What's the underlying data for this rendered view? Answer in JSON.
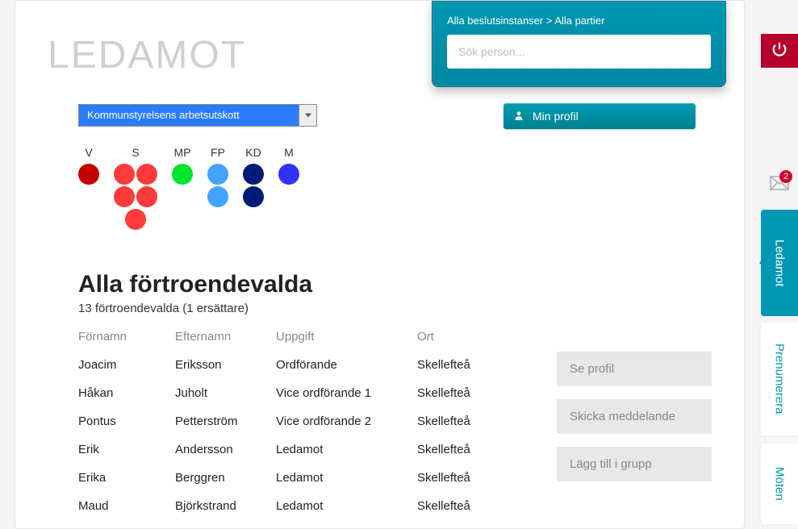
{
  "title": "LEDAMOT",
  "search": {
    "breadcrumb": "Alla beslutsinstanser > Alla partier",
    "placeholder": "Sök person..."
  },
  "dropdown": {
    "selected": "Kommunstyrelsens arbetsutskott"
  },
  "profile_button": "Min profil",
  "parties": [
    {
      "code": "V",
      "color": "#c40000",
      "rows": [
        [
          1
        ]
      ]
    },
    {
      "code": "S",
      "color": "#ff3a3a",
      "rows": [
        [
          1,
          1
        ],
        [
          1,
          1
        ],
        [
          1
        ]
      ]
    },
    {
      "code": "MP",
      "color": "#00e52e",
      "rows": [
        [
          1
        ]
      ]
    },
    {
      "code": "FP",
      "color": "#40a4ff",
      "rows": [
        [
          1
        ],
        [
          1
        ]
      ]
    },
    {
      "code": "KD",
      "color": "#001a78",
      "rows": [
        [
          1
        ],
        [
          1
        ]
      ]
    },
    {
      "code": "M",
      "color": "#3030ff",
      "rows": [
        [
          1
        ]
      ]
    }
  ],
  "section": {
    "title": "Alla förtroendevalda",
    "subtitle": "13 förtroendevalda (1 ersättare)",
    "columns": {
      "fornamn": "Förnamn",
      "efternamn": "Efternamn",
      "uppgift": "Uppgift",
      "ort": "Ort"
    },
    "rows": [
      {
        "fornamn": "Joacim",
        "efternamn": "Eriksson",
        "uppgift": "Ordförande",
        "ort": "Skellefteå"
      },
      {
        "fornamn": "Håkan",
        "efternamn": "Juholt",
        "uppgift": "Vice ordförande 1",
        "ort": "Skellefteå"
      },
      {
        "fornamn": "Pontus",
        "efternamn": "Petterström",
        "uppgift": "Vice ordförande 2",
        "ort": "Skellefteå"
      },
      {
        "fornamn": "Erik",
        "efternamn": "Andersson",
        "uppgift": "Ledamot",
        "ort": "Skellefteå"
      },
      {
        "fornamn": "Erika",
        "efternamn": "Berggren",
        "uppgift": "Ledamot",
        "ort": "Skellefteå"
      },
      {
        "fornamn": "Maud",
        "efternamn": "Björkstrand",
        "uppgift": "Ledamot",
        "ort": "Skellefteå"
      }
    ]
  },
  "actions": {
    "view_profile": "Se profil",
    "send_message": "Skicka meddelande",
    "add_to_group": "Lägg till i grupp"
  },
  "rail": {
    "notifications": "2",
    "tabs": {
      "ledamot": "Ledamot",
      "prenumerera": "Prenumerera",
      "moten": "Möten"
    }
  }
}
